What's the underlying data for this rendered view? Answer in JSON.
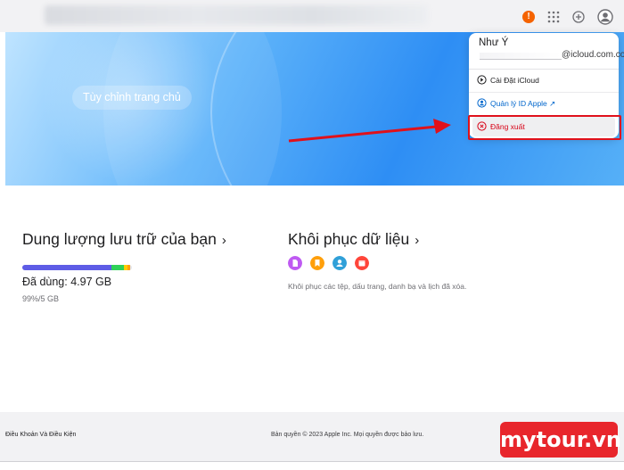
{
  "topbar": {
    "alert_glyph": "!",
    "icons": [
      "alert-icon",
      "apps-grid-icon",
      "add-circle-icon",
      "account-icon"
    ]
  },
  "hero": {
    "customize_label": "Tùy chỉnh trang chủ"
  },
  "account_menu": {
    "name": "Như Ý",
    "email_suffix": "@icloud.com.com",
    "items": [
      {
        "label": "Cài Đặt iCloud",
        "icon": "settings-icon"
      },
      {
        "label": "Quản lý ID Apple ↗",
        "icon": "person-circle-icon"
      },
      {
        "label": "Đăng xuất",
        "icon": "close-circle-icon"
      }
    ]
  },
  "storage": {
    "title": "Dung lượng lưu trữ của bạn",
    "chevron": "›",
    "used_label": "Đã dùng: 4.97 GB",
    "quota_label": "99%/5 GB",
    "used_fraction": 0.99,
    "segment_colors": [
      "#5e5ce6",
      "#30d158",
      "#ffcc00",
      "#ff9f0a"
    ]
  },
  "recovery": {
    "title": "Khôi phục dữ liệu",
    "chevron": "›",
    "description": "Khôi phục các tệp, dấu trang, danh bạ và lịch đã xóa.",
    "icons": [
      "files-icon",
      "bookmarks-icon",
      "contacts-icon",
      "calendar-icon"
    ]
  },
  "footer": {
    "terms": "Điều Khoản Và Điều Kiện",
    "copyright": "Bản quyền © 2023 Apple Inc. Mọi quyền được bảo lưu."
  },
  "watermark": {
    "text": "mytour.vn"
  },
  "colors": {
    "accent_link": "#0066cc",
    "logout_red": "#d70015",
    "highlight_red": "#e0111b",
    "alert_orange": "#f56300"
  }
}
